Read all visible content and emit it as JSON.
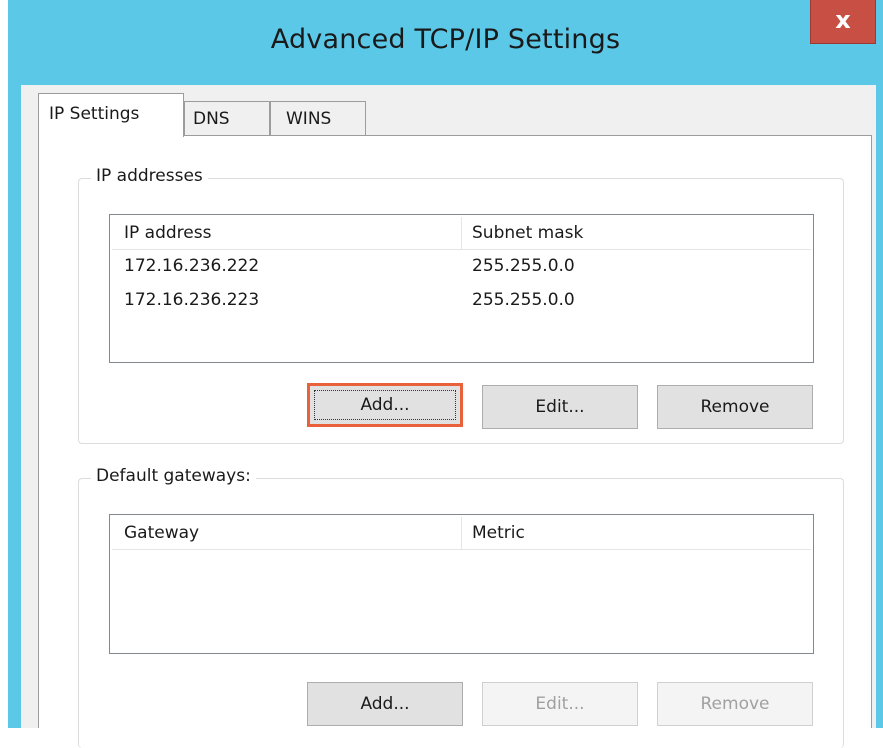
{
  "window": {
    "title": "Advanced TCP/IP Settings",
    "close_label": "x",
    "title_bar_color": "#5cc8e8",
    "close_button_color": "#c74f44",
    "highlight_color": "#e8613a"
  },
  "tabs": [
    {
      "label": "IP Settings",
      "selected": true
    },
    {
      "label": "DNS",
      "selected": false
    },
    {
      "label": "WINS",
      "selected": false
    }
  ],
  "ip_addresses": {
    "legend": "IP addresses",
    "columns": [
      "IP address",
      "Subnet mask"
    ],
    "rows": [
      {
        "ip": "172.16.236.222",
        "mask": "255.255.0.0"
      },
      {
        "ip": "172.16.236.223",
        "mask": "255.255.0.0"
      }
    ],
    "buttons": {
      "add": "Add...",
      "edit": "Edit...",
      "remove": "Remove"
    }
  },
  "default_gateways": {
    "legend": "Default gateways:",
    "columns": [
      "Gateway",
      "Metric"
    ],
    "rows": [],
    "buttons": {
      "add": "Add...",
      "edit": "Edit...",
      "remove": "Remove"
    }
  }
}
